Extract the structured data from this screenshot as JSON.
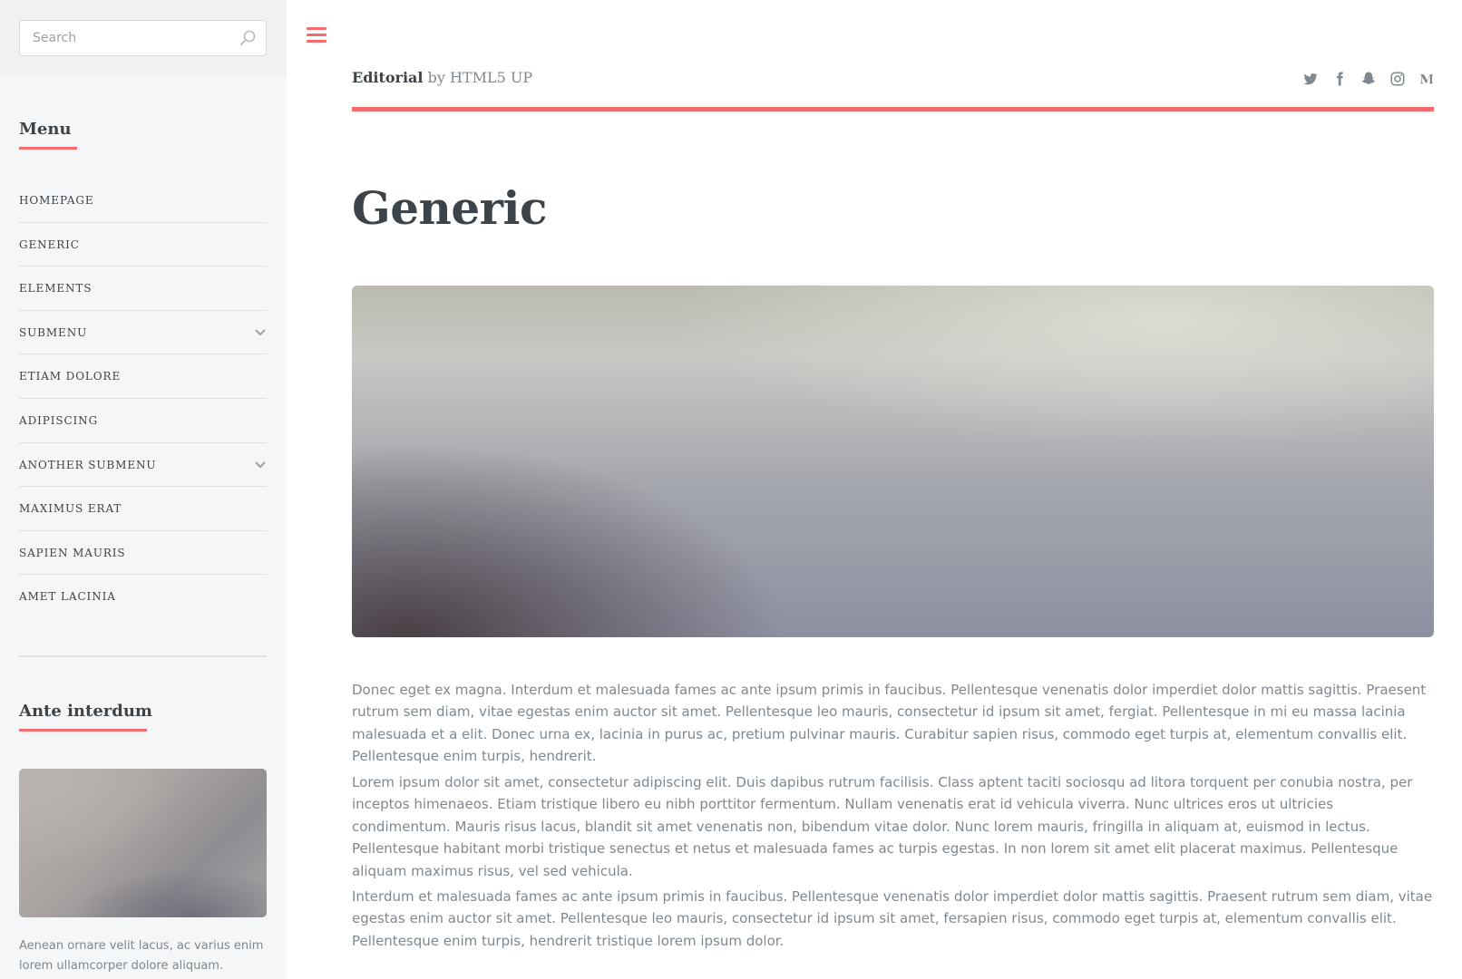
{
  "search": {
    "placeholder": "Search"
  },
  "sidebar": {
    "menu_heading": "Menu",
    "menu_items": [
      {
        "label": "HOMEPAGE",
        "has_submenu": false
      },
      {
        "label": "GENERIC",
        "has_submenu": false
      },
      {
        "label": "ELEMENTS",
        "has_submenu": false
      },
      {
        "label": "SUBMENU",
        "has_submenu": true
      },
      {
        "label": "ETIAM DOLORE",
        "has_submenu": false
      },
      {
        "label": "ADIPISCING",
        "has_submenu": false
      },
      {
        "label": "ANOTHER SUBMENU",
        "has_submenu": true
      },
      {
        "label": "MAXIMUS ERAT",
        "has_submenu": false
      },
      {
        "label": "SAPIEN MAURIS",
        "has_submenu": false
      },
      {
        "label": "AMET LACINIA",
        "has_submenu": false
      }
    ],
    "feature_heading": "Ante interdum",
    "feature_text": "Aenean ornare velit lacus, ac varius enim lorem ullamcorper dolore aliquam."
  },
  "header": {
    "logo_bold": "Editorial",
    "logo_rest": " by HTML5 UP",
    "socials": [
      "twitter-icon",
      "facebook-icon",
      "snapchat-icon",
      "instagram-icon",
      "medium-icon"
    ]
  },
  "main": {
    "title": "Generic",
    "paragraphs": [
      "Donec eget ex magna. Interdum et malesuada fames ac ante ipsum primis in faucibus. Pellentesque venenatis dolor imperdiet dolor mattis sagittis. Praesent rutrum sem diam, vitae egestas enim auctor sit amet. Pellentesque leo mauris, consectetur id ipsum sit amet, fergiat. Pellentesque in mi eu massa lacinia malesuada et a elit. Donec urna ex, lacinia in purus ac, pretium pulvinar mauris. Curabitur sapien risus, commodo eget turpis at, elementum convallis elit. Pellentesque enim turpis, hendrerit.",
      "Lorem ipsum dolor sit amet, consectetur adipiscing elit. Duis dapibus rutrum facilisis. Class aptent taciti sociosqu ad litora torquent per conubia nostra, per inceptos himenaeos. Etiam tristique libero eu nibh porttitor fermentum. Nullam venenatis erat id vehicula viverra. Nunc ultrices eros ut ultricies condimentum. Mauris risus lacus, blandit sit amet venenatis non, bibendum vitae dolor. Nunc lorem mauris, fringilla in aliquam at, euismod in lectus. Pellentesque habitant morbi tristique senectus et netus et malesuada fames ac turpis egestas. In non lorem sit amet elit placerat maximus. Pellentesque aliquam maximus risus, vel sed vehicula.",
      "Interdum et malesuada fames ac ante ipsum primis in faucibus. Pellentesque venenatis dolor imperdiet dolor mattis sagittis. Praesent rutrum sem diam, vitae egestas enim auctor sit amet. Pellentesque leo mauris, consectetur id ipsum sit amet, fersapien risus, commodo eget turpis at, elementum convallis elit. Pellentesque enim turpis, hendrerit tristique lorem ipsum dolor."
    ]
  },
  "colors": {
    "accent": "#f56a6a",
    "heading": "#3d4449",
    "text": "#7f888f",
    "sidebar_bg": "#f5f6f7"
  }
}
